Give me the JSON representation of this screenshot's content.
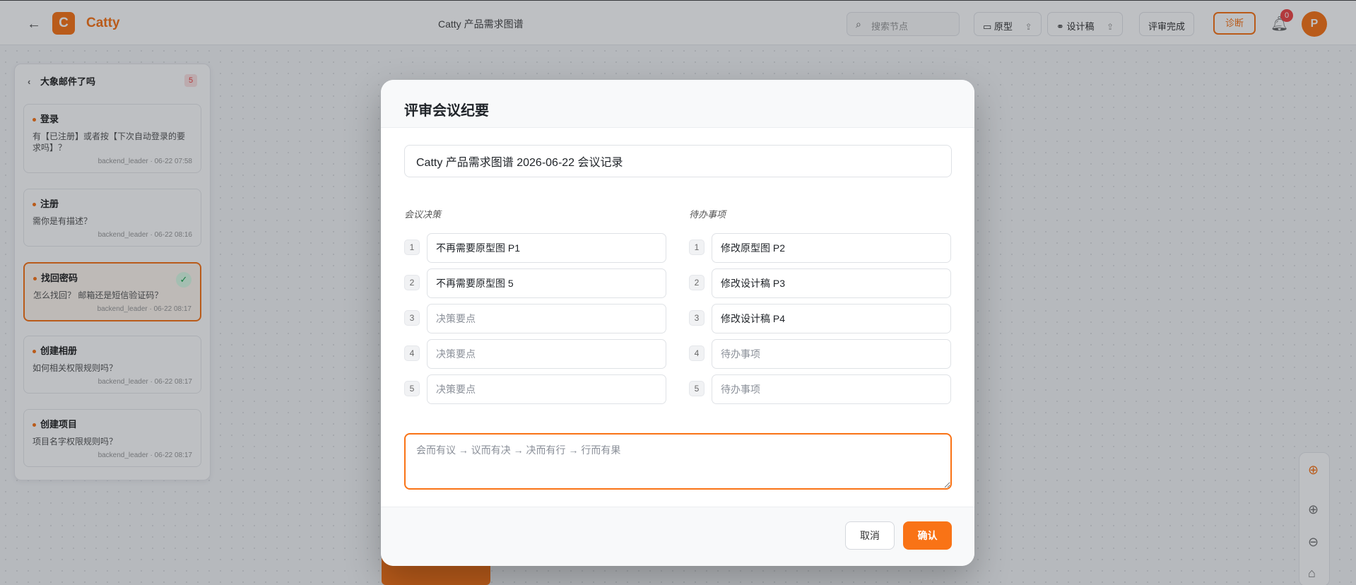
{
  "topbar": {
    "brand": "Catty",
    "logo_letter": "C",
    "doc_title": "Catty 产品需求图谱",
    "search_placeholder": "搜索节点",
    "prototype_label": "原型",
    "design_label": "设计稿",
    "review_done_label": "评审完成",
    "action_label": "诊断",
    "notification_count": "0",
    "avatar_letter": "P"
  },
  "sidebar": {
    "title": "大象邮件了吗",
    "count": "5",
    "cards": [
      {
        "title": "登录",
        "text": "有【已注册】或者按【下次自动登录的要求吗】？",
        "meta": "backend_leader · 06-22 07:58"
      },
      {
        "title": "注册",
        "text": "需你是有描述？",
        "meta": "backend_leader · 06-22 08:16"
      },
      {
        "title": "找回密码",
        "text": "怎么找回？ 邮箱还是短信验证码？",
        "meta": "backend_leader · 06-22 08:17"
      },
      {
        "title": "创建相册",
        "text": "如何相关权限规则吗？",
        "meta": "backend_leader · 06-22 08:17"
      },
      {
        "title": "创建项目",
        "text": "项目名字权限规则吗？",
        "meta": "backend_leader · 06-22 08:17"
      }
    ]
  },
  "modal": {
    "title": "评审会议纪要",
    "record_title": "Catty 产品需求图谱 2026-06-22 会议记录",
    "decisions_label": "会议决策",
    "todos_label": "待办事项",
    "decisions": [
      {
        "num": "1",
        "value": "不再需要原型图 P1",
        "placeholder": "决策要点"
      },
      {
        "num": "2",
        "value": "不再需要原型图 5",
        "placeholder": "决策要点"
      },
      {
        "num": "3",
        "value": "",
        "placeholder": "决策要点"
      },
      {
        "num": "4",
        "value": "",
        "placeholder": "决策要点"
      },
      {
        "num": "5",
        "value": "",
        "placeholder": "决策要点"
      }
    ],
    "todos": [
      {
        "num": "1",
        "value": "修改原型图 P2",
        "placeholder": "待办事项"
      },
      {
        "num": "2",
        "value": "修改设计稿 P3",
        "placeholder": "待办事项"
      },
      {
        "num": "3",
        "value": "修改设计稿 P4",
        "placeholder": "待办事项"
      },
      {
        "num": "4",
        "value": "",
        "placeholder": "待办事项"
      },
      {
        "num": "5",
        "value": "",
        "placeholder": "待办事项"
      }
    ],
    "note_placeholder": "会而有议 → 议而有决 → 决而有行 → 行而有果",
    "cancel_label": "取消",
    "confirm_label": "确认"
  },
  "colors": {
    "accent": "#f97316",
    "overlay": "rgba(22,28,40,0.28)"
  }
}
